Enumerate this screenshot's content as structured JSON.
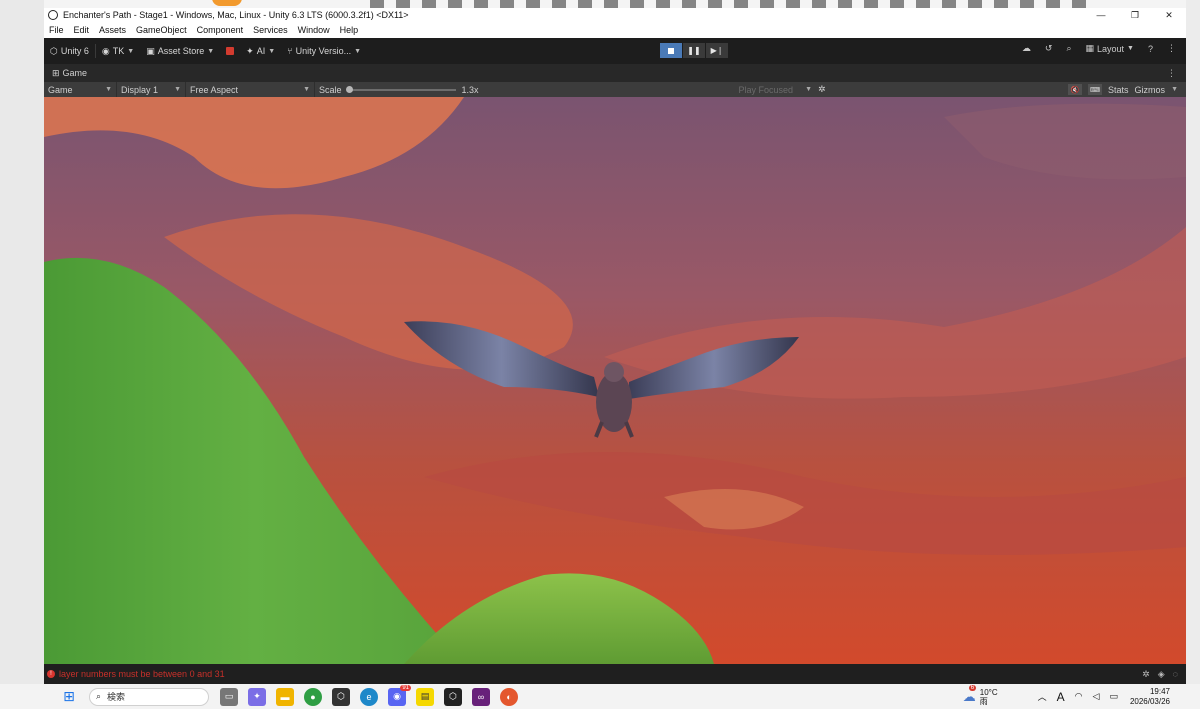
{
  "window": {
    "title": "Enchanter's Path - Stage1 - Windows, Mac, Linux - Unity 6.3 LTS (6000.3.2f1) <DX11>",
    "controls": [
      "—",
      "❐",
      "✕"
    ]
  },
  "menu": [
    "File",
    "Edit",
    "Assets",
    "GameObject",
    "Component",
    "Services",
    "Window",
    "Help"
  ],
  "toolbar": {
    "unity_label": "Unity 6",
    "account_label": "TK",
    "asset_store_label": "Asset Store",
    "ai_label": "AI",
    "version_control_label": "Unity Versio...",
    "layout_label": "Layout"
  },
  "game_tab": {
    "label": "Game"
  },
  "game_toolbar": {
    "mode": "Game",
    "display": "Display 1",
    "aspect": "Free Aspect",
    "scale_label": "Scale",
    "scale_value": "1.3x",
    "play_mode": "Play Focused",
    "stats_label": "Stats",
    "gizmos_label": "Gizmos"
  },
  "status": {
    "error_message": "layer numbers must be between 0 and 31"
  },
  "taskbar": {
    "search_placeholder": "検索",
    "weather_temp": "10°C",
    "weather_desc": "雨",
    "weather_badge": "6",
    "discord_badge": "91",
    "ime_label": "A",
    "time": "19:47",
    "date": "2026/03/26"
  },
  "colors": {
    "play_active": "#4a7ab7",
    "error": "#c7302a",
    "sky_top": "#7d5670",
    "sky_horizon": "#cf4a30",
    "grass": "#5fae3e"
  }
}
